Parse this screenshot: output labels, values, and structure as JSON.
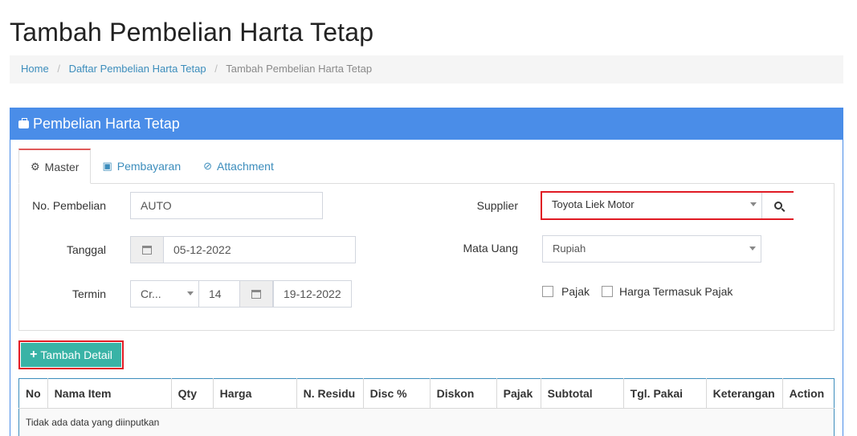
{
  "page": {
    "title": "Tambah Pembelian Harta Tetap"
  },
  "breadcrumb": {
    "home": "Home",
    "list": "Daftar Pembelian Harta Tetap",
    "current": "Tambah Pembelian Harta Tetap",
    "separator": "/"
  },
  "panel": {
    "title": "Pembelian Harta Tetap",
    "icon": "briefcase-icon",
    "color": "#4a8de8"
  },
  "tabs": [
    {
      "label": "Master",
      "icon": "cogs-icon",
      "active": true
    },
    {
      "label": "Pembayaran",
      "icon": "money-icon",
      "active": false
    },
    {
      "label": "Attachment",
      "icon": "paperclip-icon",
      "active": false
    }
  ],
  "form": {
    "no_pembelian": {
      "label": "No. Pembelian",
      "value": "AUTO"
    },
    "tanggal": {
      "label": "Tanggal",
      "value": "05-12-2022"
    },
    "termin": {
      "label": "Termin",
      "type_value": "Cr...",
      "days_value": "14",
      "date_value": "19-12-2022"
    },
    "supplier": {
      "label": "Supplier",
      "value": "Toyota Liek Motor"
    },
    "mata_uang": {
      "label": "Mata Uang",
      "value": "Rupiah"
    },
    "pajak": {
      "label": "Pajak",
      "checked": false
    },
    "harga_termasuk_pajak": {
      "label": "Harga Termasuk Pajak",
      "checked": false
    }
  },
  "actions": {
    "add_detail": "Tambah Detail",
    "add_detail_color": "#39b3a6"
  },
  "table": {
    "columns": [
      "No",
      "Nama Item",
      "Qty",
      "Harga",
      "N. Residu",
      "Disc %",
      "Diskon",
      "Pajak",
      "Subtotal",
      "Tgl. Pakai",
      "Keterangan",
      "Action"
    ],
    "empty_message": "Tidak ada data yang diinputkan"
  },
  "highlight_color": "#e01b24"
}
